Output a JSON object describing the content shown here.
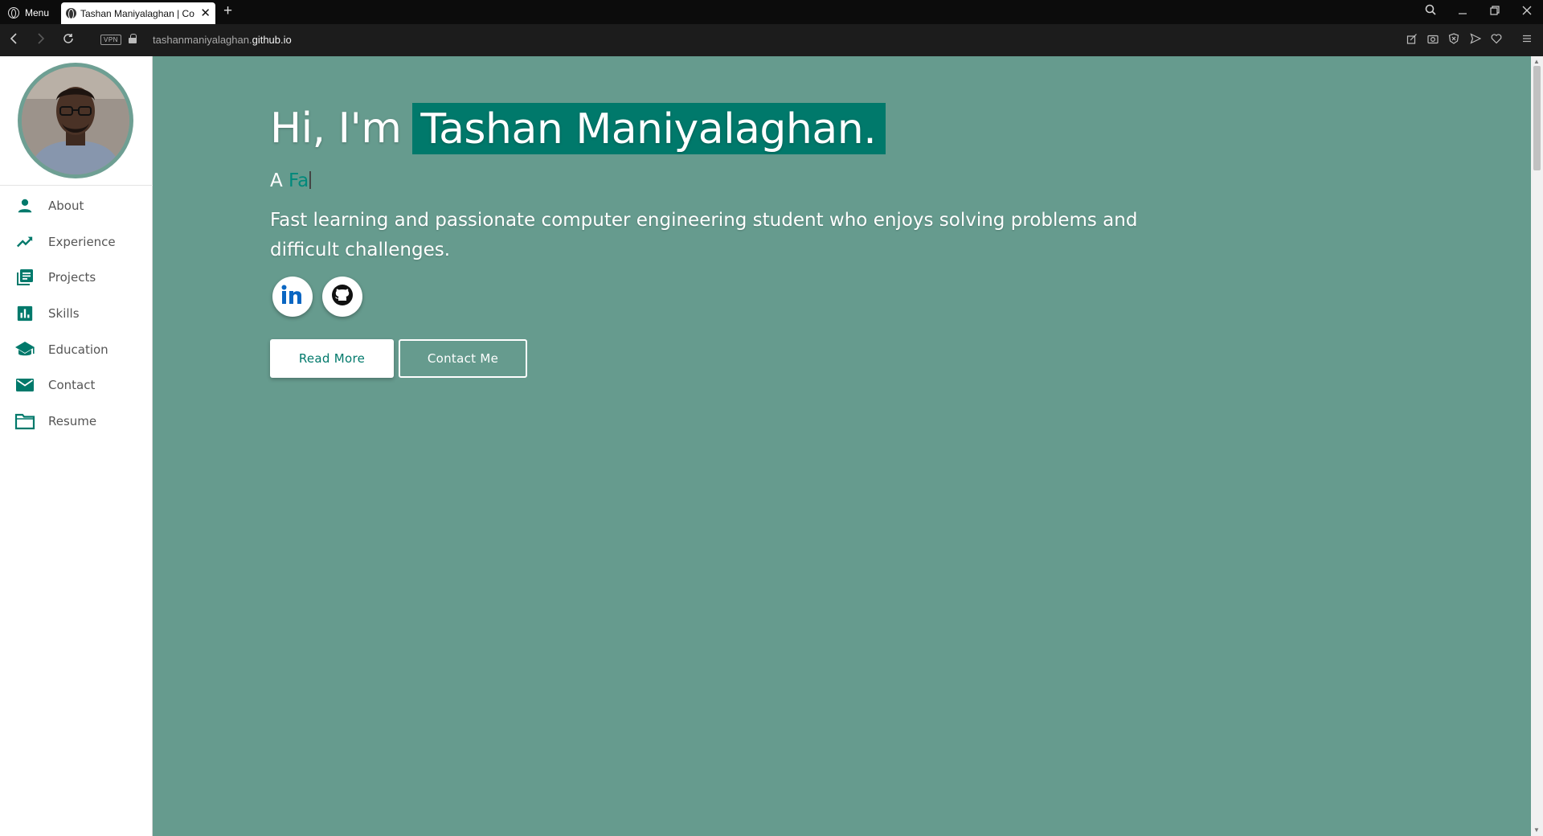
{
  "browser": {
    "menu_label": "Menu",
    "tab_title": "Tashan Maniyalaghan | Cor",
    "new_tab_symbol": "+",
    "url_prefix": "tashanmaniyalaghan.",
    "url_domain": "github.io",
    "vpn_label": "VPN"
  },
  "sidebar": {
    "items": [
      {
        "label": "About",
        "icon": "person-icon"
      },
      {
        "label": "Experience",
        "icon": "trending-up-icon"
      },
      {
        "label": "Projects",
        "icon": "library-books-icon"
      },
      {
        "label": "Skills",
        "icon": "bar-chart-icon"
      },
      {
        "label": "Education",
        "icon": "graduation-cap-icon"
      },
      {
        "label": "Contact",
        "icon": "mail-icon"
      },
      {
        "label": "Resume",
        "icon": "folder-icon"
      }
    ]
  },
  "hero": {
    "greeting": "Hi, I'm",
    "name": "Tashan Maniyalaghan.",
    "typed_prefix": "A",
    "typed_text": "Fa",
    "description": "Fast learning and passionate computer engineering student who enjoys solving problems and difficult challenges.",
    "read_more": "Read More",
    "contact_me": "Contact Me",
    "socials": [
      "linkedin-icon",
      "github-icon"
    ]
  },
  "colors": {
    "accent": "#00796b",
    "hero_bg": "#669b8e",
    "sidebar_icon": "#00796b"
  }
}
